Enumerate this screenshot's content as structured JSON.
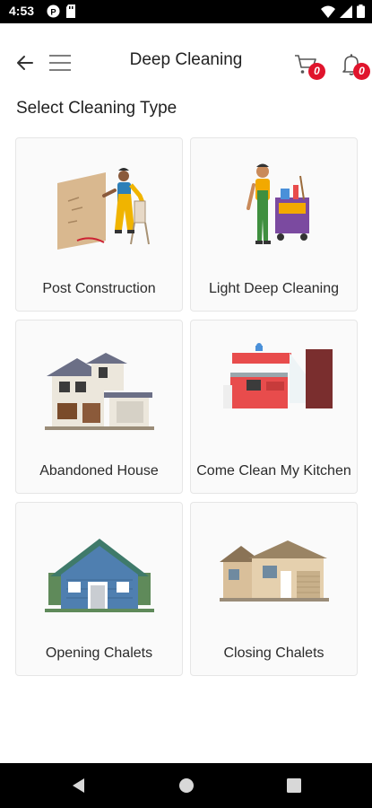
{
  "status_bar": {
    "time": "4:53",
    "icons_left": [
      "notification-icon",
      "sd-card-icon"
    ],
    "icons_right": [
      "wifi-icon",
      "signal-icon",
      "battery-icon"
    ]
  },
  "header": {
    "title": "Deep Cleaning",
    "back_icon": "arrow-left-icon",
    "menu_icon": "hamburger-menu-icon",
    "cart_icon": "cart-icon",
    "cart_count": "0",
    "notification_icon": "bell-icon",
    "notification_count": "0",
    "badge_color": "#e0142c"
  },
  "section": {
    "title": "Select Cleaning Type"
  },
  "cleaning_types": [
    {
      "label": "Post Construction",
      "icon": "worker-painting-wall-illustration"
    },
    {
      "label": "Light Deep Cleaning",
      "icon": "cleaner-with-cart-illustration"
    },
    {
      "label": "Abandoned House",
      "icon": "abandoned-house-illustration"
    },
    {
      "label": "Come Clean My Kitchen",
      "icon": "kitchen-illustration"
    },
    {
      "label": "Opening Chalets",
      "icon": "blue-chalet-illustration"
    },
    {
      "label": "Closing Chalets",
      "icon": "beige-house-illustration"
    }
  ],
  "nav_bar": {
    "icons": [
      "back-triangle-icon",
      "home-circle-icon",
      "recents-square-icon"
    ]
  }
}
